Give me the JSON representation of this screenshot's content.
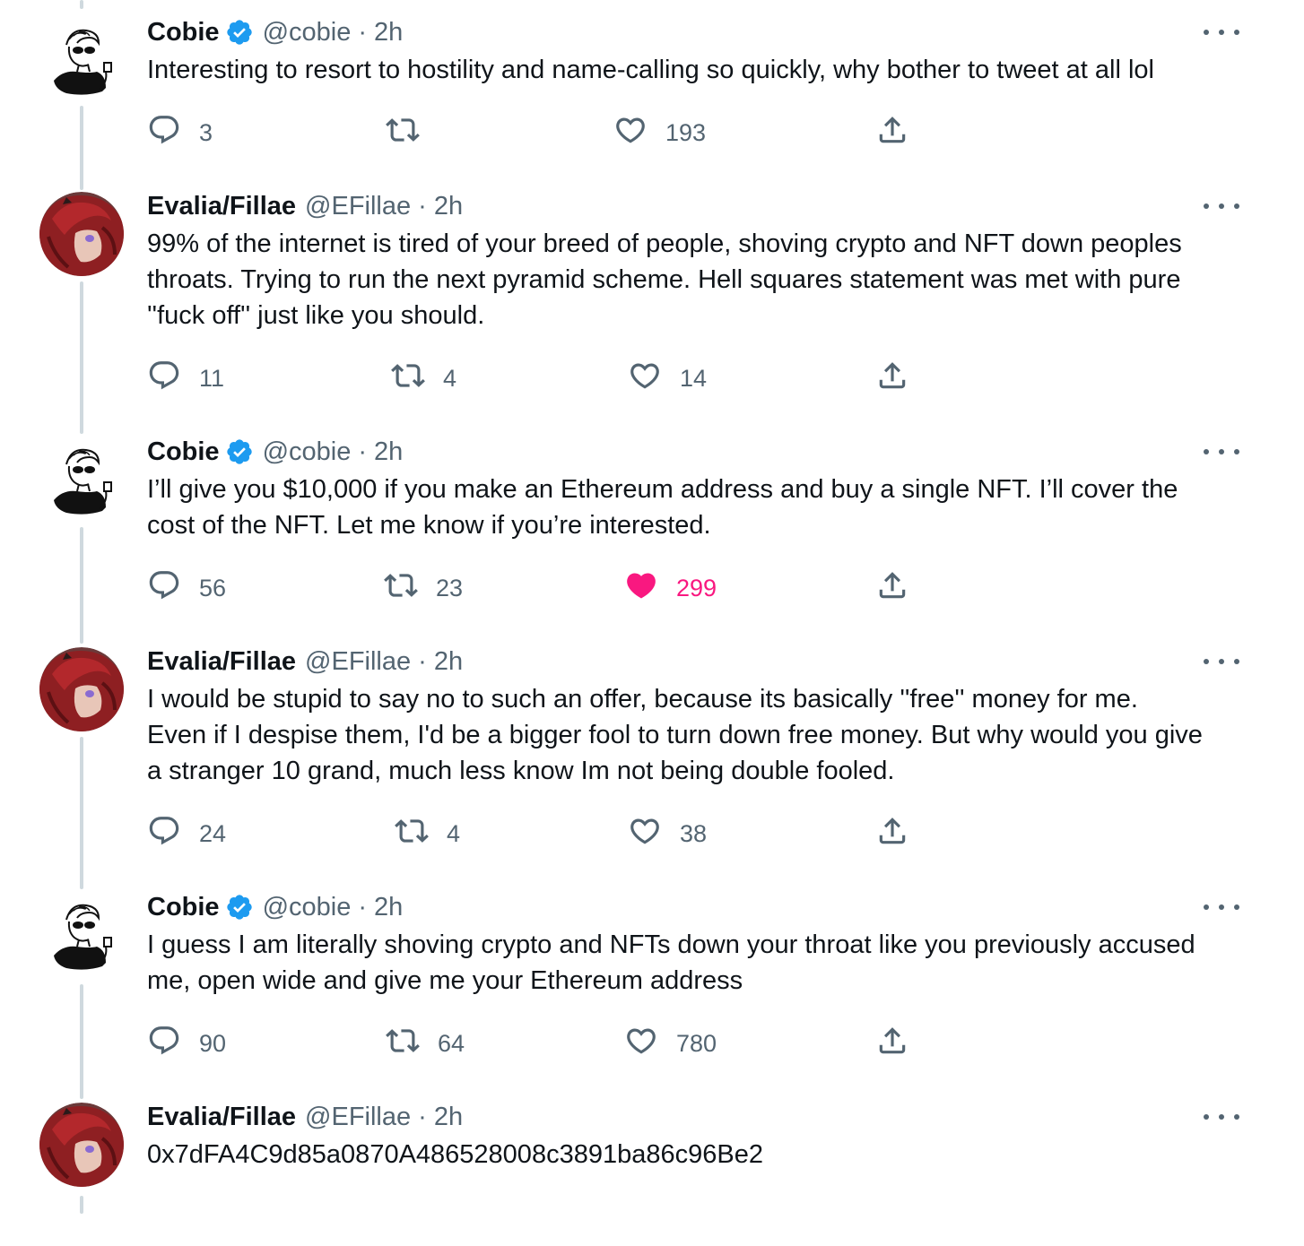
{
  "tweets": [
    {
      "name": "Cobie",
      "verified": true,
      "handle": "@cobie",
      "dot": "·",
      "time": "2h",
      "avatar": "cobie-avatar",
      "text": "Interesting to resort to hostility and name-calling so quickly, why bother to tweet at all lol",
      "replies": "3",
      "retweets": "",
      "likes": "193",
      "liked": false
    },
    {
      "name": "Evalia/Fillae",
      "verified": false,
      "handle": "@EFillae",
      "dot": "·",
      "time": "2h",
      "avatar": "evalia-avatar",
      "text": "99% of the internet is tired of your breed of people, shoving crypto and NFT down peoples\nthroats. Trying to run the next pyramid scheme. Hell squares statement was met with pure\n''fuck off'' just like you should.",
      "replies": "11",
      "retweets": "4",
      "likes": "14",
      "liked": false
    },
    {
      "name": "Cobie",
      "verified": true,
      "handle": "@cobie",
      "dot": "·",
      "time": "2h",
      "avatar": "cobie-avatar",
      "text": "I’ll give you $10,000 if you make an Ethereum address and buy a single NFT. I’ll cover the\ncost of the NFT. Let me know if you’re interested.",
      "replies": "56",
      "retweets": "23",
      "likes": "299",
      "liked": true
    },
    {
      "name": "Evalia/Fillae",
      "verified": false,
      "handle": "@EFillae",
      "dot": "·",
      "time": "2h",
      "avatar": "evalia-avatar",
      "text": "I would be stupid to say no to such an offer, because its basically ''free'' money for me.\nEven if I despise them, I'd be a bigger fool to turn down free money. But why would you give\na stranger 10 grand, much less know Im not being double fooled.",
      "replies": "24",
      "retweets": "4",
      "likes": "38",
      "liked": false
    },
    {
      "name": "Cobie",
      "verified": true,
      "handle": "@cobie",
      "dot": "·",
      "time": "2h",
      "avatar": "cobie-avatar",
      "text": "I guess I am literally shoving crypto and NFTs down your throat like you previously accused\nme, open wide and give me your Ethereum address",
      "replies": "90",
      "retweets": "64",
      "likes": "780",
      "liked": false
    },
    {
      "name": "Evalia/Fillae",
      "verified": false,
      "handle": "@EFillae",
      "dot": "·",
      "time": "2h",
      "avatar": "evalia-avatar",
      "text": "0x7dFA4C9d85a0870A486528008c3891ba86c96Be2",
      "replies": "",
      "retweets": "",
      "likes": "",
      "liked": false
    }
  ],
  "colors": {
    "verified": "#1d9bf0",
    "liked": "#f91880",
    "secondary": "#536471",
    "thread_line": "#cfd9de"
  },
  "icons": {
    "reply": "reply-icon",
    "retweet": "retweet-icon",
    "like": "heart-icon",
    "share": "share-icon",
    "more": "more-icon",
    "verified": "verified-badge-icon"
  }
}
